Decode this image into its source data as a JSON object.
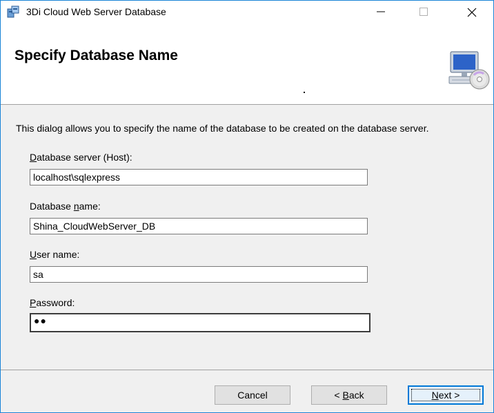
{
  "window": {
    "title": "3Di Cloud Web Server Database",
    "accent_color": "#1883d7",
    "icons": {
      "app": "installer-icon",
      "minimize": "minimize-icon",
      "maximize": "maximize-icon",
      "close": "close-icon"
    }
  },
  "banner": {
    "title": "Specify Database Name",
    "icon": "computer-cd-icon"
  },
  "description": "This dialog allows you to specify the name of the database to be created on the database server.",
  "fields": {
    "server": {
      "label_u": "D",
      "label_rest": "atabase server (Host):",
      "value": "localhost\\sqlexpress"
    },
    "dbname": {
      "label_pre": "Database ",
      "label_u": "n",
      "label_rest": "ame:",
      "value": "Shina_CloudWebServer_DB"
    },
    "user": {
      "label_u": "U",
      "label_rest": "ser name:",
      "value": "sa"
    },
    "password": {
      "label_u": "P",
      "label_rest": "assword:",
      "masked_value": "●●"
    }
  },
  "buttons": {
    "cancel": "Cancel",
    "back_pre": "< ",
    "back_u": "B",
    "back_rest": "ack",
    "next_u": "N",
    "next_rest": "ext >"
  }
}
